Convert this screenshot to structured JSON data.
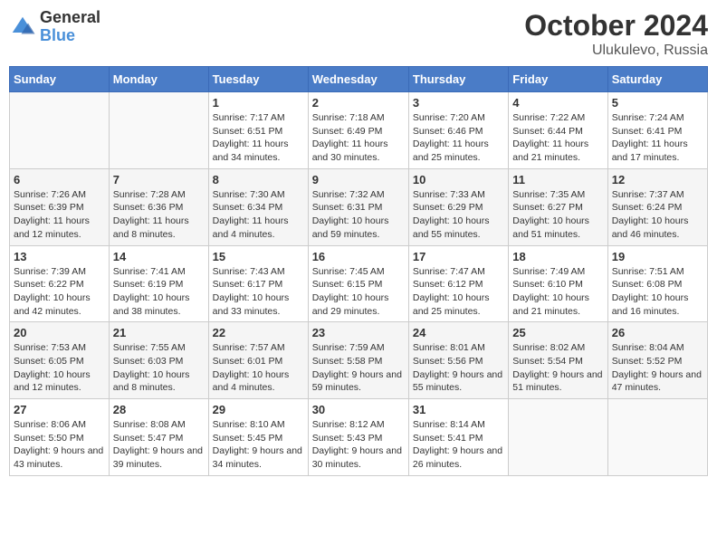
{
  "logo": {
    "general": "General",
    "blue": "Blue"
  },
  "title": {
    "month": "October 2024",
    "location": "Ulukulevo, Russia"
  },
  "weekdays": [
    "Sunday",
    "Monday",
    "Tuesday",
    "Wednesday",
    "Thursday",
    "Friday",
    "Saturday"
  ],
  "weeks": [
    [
      {
        "day": "",
        "sunrise": "",
        "sunset": "",
        "daylight": ""
      },
      {
        "day": "",
        "sunrise": "",
        "sunset": "",
        "daylight": ""
      },
      {
        "day": "1",
        "sunrise": "Sunrise: 7:17 AM",
        "sunset": "Sunset: 6:51 PM",
        "daylight": "Daylight: 11 hours and 34 minutes."
      },
      {
        "day": "2",
        "sunrise": "Sunrise: 7:18 AM",
        "sunset": "Sunset: 6:49 PM",
        "daylight": "Daylight: 11 hours and 30 minutes."
      },
      {
        "day": "3",
        "sunrise": "Sunrise: 7:20 AM",
        "sunset": "Sunset: 6:46 PM",
        "daylight": "Daylight: 11 hours and 25 minutes."
      },
      {
        "day": "4",
        "sunrise": "Sunrise: 7:22 AM",
        "sunset": "Sunset: 6:44 PM",
        "daylight": "Daylight: 11 hours and 21 minutes."
      },
      {
        "day": "5",
        "sunrise": "Sunrise: 7:24 AM",
        "sunset": "Sunset: 6:41 PM",
        "daylight": "Daylight: 11 hours and 17 minutes."
      }
    ],
    [
      {
        "day": "6",
        "sunrise": "Sunrise: 7:26 AM",
        "sunset": "Sunset: 6:39 PM",
        "daylight": "Daylight: 11 hours and 12 minutes."
      },
      {
        "day": "7",
        "sunrise": "Sunrise: 7:28 AM",
        "sunset": "Sunset: 6:36 PM",
        "daylight": "Daylight: 11 hours and 8 minutes."
      },
      {
        "day": "8",
        "sunrise": "Sunrise: 7:30 AM",
        "sunset": "Sunset: 6:34 PM",
        "daylight": "Daylight: 11 hours and 4 minutes."
      },
      {
        "day": "9",
        "sunrise": "Sunrise: 7:32 AM",
        "sunset": "Sunset: 6:31 PM",
        "daylight": "Daylight: 10 hours and 59 minutes."
      },
      {
        "day": "10",
        "sunrise": "Sunrise: 7:33 AM",
        "sunset": "Sunset: 6:29 PM",
        "daylight": "Daylight: 10 hours and 55 minutes."
      },
      {
        "day": "11",
        "sunrise": "Sunrise: 7:35 AM",
        "sunset": "Sunset: 6:27 PM",
        "daylight": "Daylight: 10 hours and 51 minutes."
      },
      {
        "day": "12",
        "sunrise": "Sunrise: 7:37 AM",
        "sunset": "Sunset: 6:24 PM",
        "daylight": "Daylight: 10 hours and 46 minutes."
      }
    ],
    [
      {
        "day": "13",
        "sunrise": "Sunrise: 7:39 AM",
        "sunset": "Sunset: 6:22 PM",
        "daylight": "Daylight: 10 hours and 42 minutes."
      },
      {
        "day": "14",
        "sunrise": "Sunrise: 7:41 AM",
        "sunset": "Sunset: 6:19 PM",
        "daylight": "Daylight: 10 hours and 38 minutes."
      },
      {
        "day": "15",
        "sunrise": "Sunrise: 7:43 AM",
        "sunset": "Sunset: 6:17 PM",
        "daylight": "Daylight: 10 hours and 33 minutes."
      },
      {
        "day": "16",
        "sunrise": "Sunrise: 7:45 AM",
        "sunset": "Sunset: 6:15 PM",
        "daylight": "Daylight: 10 hours and 29 minutes."
      },
      {
        "day": "17",
        "sunrise": "Sunrise: 7:47 AM",
        "sunset": "Sunset: 6:12 PM",
        "daylight": "Daylight: 10 hours and 25 minutes."
      },
      {
        "day": "18",
        "sunrise": "Sunrise: 7:49 AM",
        "sunset": "Sunset: 6:10 PM",
        "daylight": "Daylight: 10 hours and 21 minutes."
      },
      {
        "day": "19",
        "sunrise": "Sunrise: 7:51 AM",
        "sunset": "Sunset: 6:08 PM",
        "daylight": "Daylight: 10 hours and 16 minutes."
      }
    ],
    [
      {
        "day": "20",
        "sunrise": "Sunrise: 7:53 AM",
        "sunset": "Sunset: 6:05 PM",
        "daylight": "Daylight: 10 hours and 12 minutes."
      },
      {
        "day": "21",
        "sunrise": "Sunrise: 7:55 AM",
        "sunset": "Sunset: 6:03 PM",
        "daylight": "Daylight: 10 hours and 8 minutes."
      },
      {
        "day": "22",
        "sunrise": "Sunrise: 7:57 AM",
        "sunset": "Sunset: 6:01 PM",
        "daylight": "Daylight: 10 hours and 4 minutes."
      },
      {
        "day": "23",
        "sunrise": "Sunrise: 7:59 AM",
        "sunset": "Sunset: 5:58 PM",
        "daylight": "Daylight: 9 hours and 59 minutes."
      },
      {
        "day": "24",
        "sunrise": "Sunrise: 8:01 AM",
        "sunset": "Sunset: 5:56 PM",
        "daylight": "Daylight: 9 hours and 55 minutes."
      },
      {
        "day": "25",
        "sunrise": "Sunrise: 8:02 AM",
        "sunset": "Sunset: 5:54 PM",
        "daylight": "Daylight: 9 hours and 51 minutes."
      },
      {
        "day": "26",
        "sunrise": "Sunrise: 8:04 AM",
        "sunset": "Sunset: 5:52 PM",
        "daylight": "Daylight: 9 hours and 47 minutes."
      }
    ],
    [
      {
        "day": "27",
        "sunrise": "Sunrise: 8:06 AM",
        "sunset": "Sunset: 5:50 PM",
        "daylight": "Daylight: 9 hours and 43 minutes."
      },
      {
        "day": "28",
        "sunrise": "Sunrise: 8:08 AM",
        "sunset": "Sunset: 5:47 PM",
        "daylight": "Daylight: 9 hours and 39 minutes."
      },
      {
        "day": "29",
        "sunrise": "Sunrise: 8:10 AM",
        "sunset": "Sunset: 5:45 PM",
        "daylight": "Daylight: 9 hours and 34 minutes."
      },
      {
        "day": "30",
        "sunrise": "Sunrise: 8:12 AM",
        "sunset": "Sunset: 5:43 PM",
        "daylight": "Daylight: 9 hours and 30 minutes."
      },
      {
        "day": "31",
        "sunrise": "Sunrise: 8:14 AM",
        "sunset": "Sunset: 5:41 PM",
        "daylight": "Daylight: 9 hours and 26 minutes."
      },
      {
        "day": "",
        "sunrise": "",
        "sunset": "",
        "daylight": ""
      },
      {
        "day": "",
        "sunrise": "",
        "sunset": "",
        "daylight": ""
      }
    ]
  ]
}
